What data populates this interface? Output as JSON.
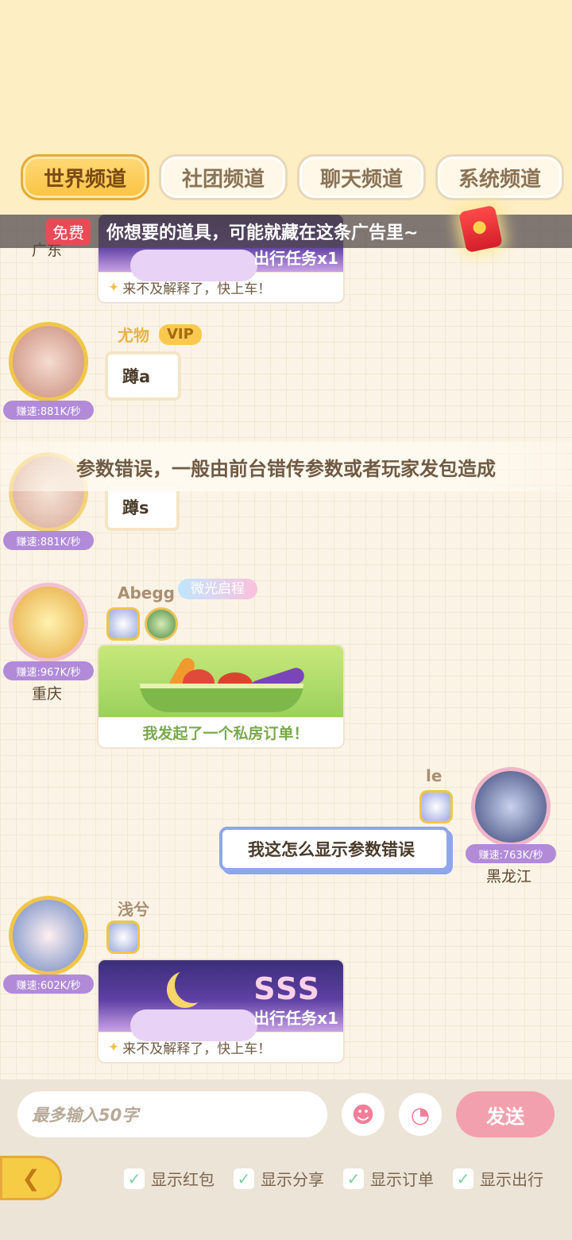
{
  "tabs": [
    {
      "label": "世界频道",
      "active": true
    },
    {
      "label": "社团频道",
      "active": false
    },
    {
      "label": "聊天频道",
      "active": false
    },
    {
      "label": "系统频道",
      "active": false
    }
  ],
  "ad": {
    "free_label": "免费",
    "text": "你想要的道具，可能就藏在这条广告里~"
  },
  "messages": [
    {
      "region": "广东",
      "card_task": "出行任务x1",
      "card_caption": "来不及解释了，快上车！"
    },
    {
      "username": "尤物",
      "vip": "VIP",
      "speed": "赚速:881K/秒",
      "text": "蹲a"
    },
    {
      "speed": "赚速:881K/秒",
      "text": "蹲s"
    },
    {
      "username": "Abegg",
      "tag": "微光启程",
      "speed": "赚速:967K/秒",
      "region": "重庆",
      "card_caption": "我发起了一个私房订单！"
    },
    {
      "username": "le",
      "speed": "赚速:763K/秒",
      "region": "黑龙江",
      "text": "我这怎么显示参数错误"
    },
    {
      "username": "浅兮",
      "speed": "赚速:602K/秒",
      "card_sss": "SSS",
      "card_task": "出行任务x1",
      "card_caption": "来不及解释了，快上车！"
    }
  ],
  "toast": "参数错误，一般由前台错传参数或者玩家发包造成",
  "input": {
    "placeholder": "最多输入50字",
    "send_label": "发送"
  },
  "checks": [
    "显示红包",
    "显示分享",
    "显示订单",
    "显示出行"
  ],
  "colors": {
    "accent": "#f9c342",
    "send": "#f3a0ae",
    "speed_badge": "#b18ad8"
  }
}
